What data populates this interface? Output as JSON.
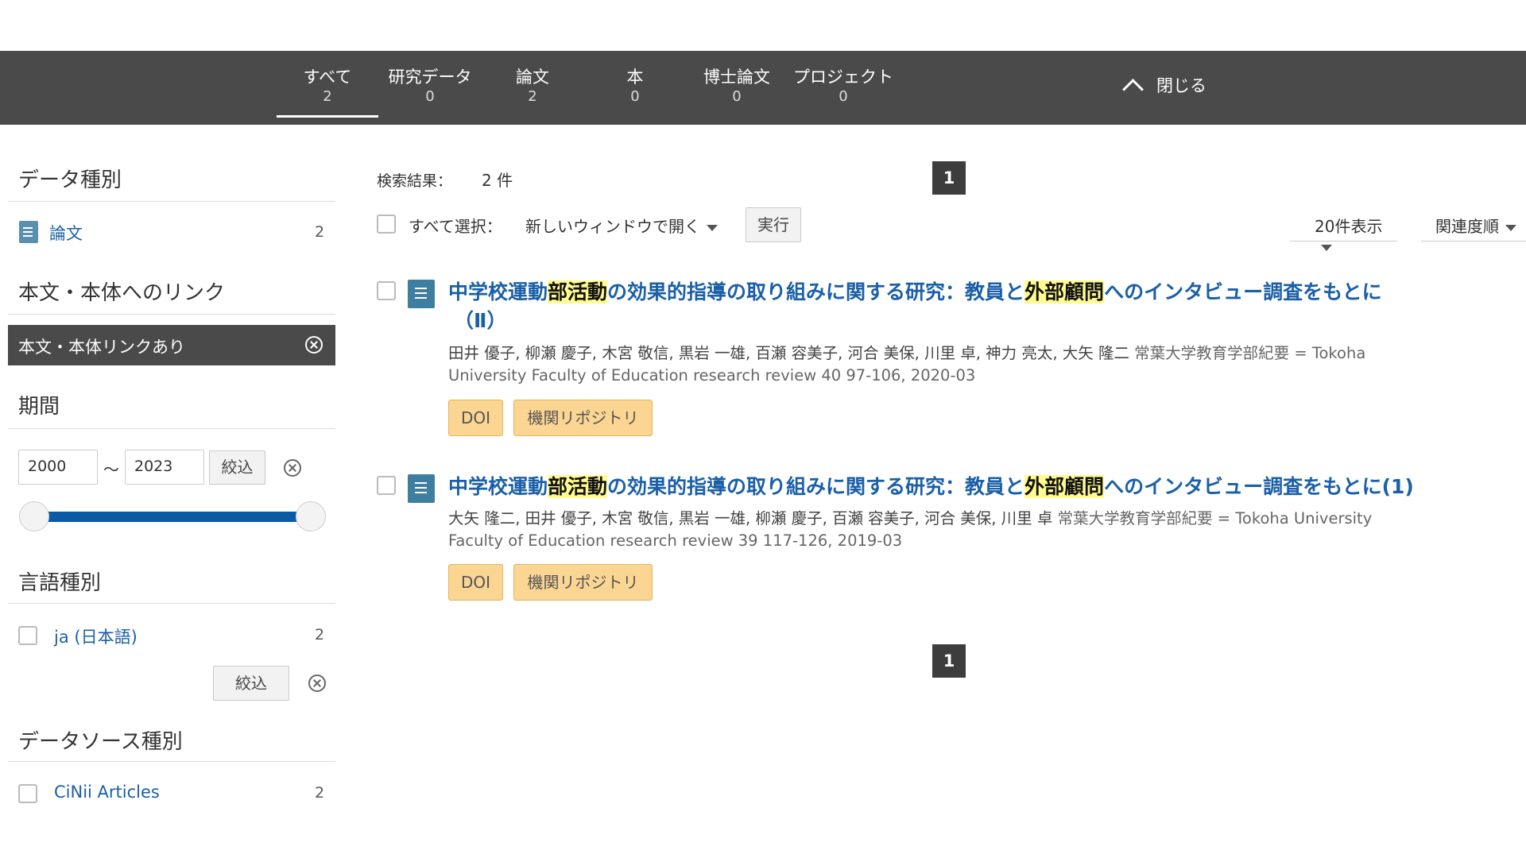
{
  "tabs": [
    {
      "label": "すべて",
      "count": "2"
    },
    {
      "label": "研究データ",
      "count": "0"
    },
    {
      "label": "論文",
      "count": "2"
    },
    {
      "label": "本",
      "count": "0"
    },
    {
      "label": "博士論文",
      "count": "0"
    },
    {
      "label": "プロジェクト",
      "count": "0"
    }
  ],
  "close_label": "閉じる",
  "sidebar": {
    "data_type": {
      "heading": "データ種別",
      "item_label": "論文",
      "item_count": "2"
    },
    "fulltext": {
      "heading": "本文・本体へのリンク",
      "active_filter": "本文・本体リンクあり"
    },
    "period": {
      "heading": "期間",
      "from": "2000",
      "separator": "～",
      "to": "2023",
      "button": "絞込",
      "slider_min": 2000,
      "slider_max": 2023
    },
    "language": {
      "heading": "言語種別",
      "item_label": "ja (日本語)",
      "item_count": "2",
      "button": "絞込"
    },
    "datasource": {
      "heading": "データソース種別",
      "item_label": "CiNii Articles",
      "item_count": "2"
    }
  },
  "results": {
    "summary_label": "検索結果：",
    "summary_count": "2 件",
    "page": "1",
    "select_all": "すべて選択：",
    "open_action": "新しいウィンドウで開く",
    "execute": "実行",
    "per_page": "20件表示",
    "sort": "関連度順",
    "items": [
      {
        "title_parts": [
          "中学校運動",
          "部活動",
          "の効果的指導の取り組みに関する研究：教員と",
          "外部顧問",
          "へのインタビュー調査をもとに"
        ],
        "title_line2": "（Ⅱ）",
        "authors": "田井 優子, 柳瀬 慶子, 木宮 敬信, 黒岩 一雄, 百瀬 容美子, 河合 美保, 川里 卓, 神力 亮太, 大矢 隆二",
        "journal_1": "常葉大学教育学部紀要 = Tokoha",
        "journal_2": "University Faculty of Education research review 40 97-106, 2020-03",
        "tags": [
          "DOI",
          "機関リポジトリ"
        ]
      },
      {
        "title_parts": [
          "中学校運動",
          "部活動",
          "の効果的指導の取り組みに関する研究：教員と",
          "外部顧問",
          "へのインタビュー調査をもとに(1)"
        ],
        "authors": "大矢 隆二, 田井 優子, 木宮 敬信, 黒岩 一雄, 柳瀬 慶子, 百瀬 容美子, 河合 美保, 川里 卓",
        "journal_1": "常葉大学教育学部紀要 = Tokoha University",
        "journal_2": "Faculty of Education research review 39 117-126, 2019-03",
        "tags": [
          "DOI",
          "機関リポジトリ"
        ]
      }
    ]
  }
}
